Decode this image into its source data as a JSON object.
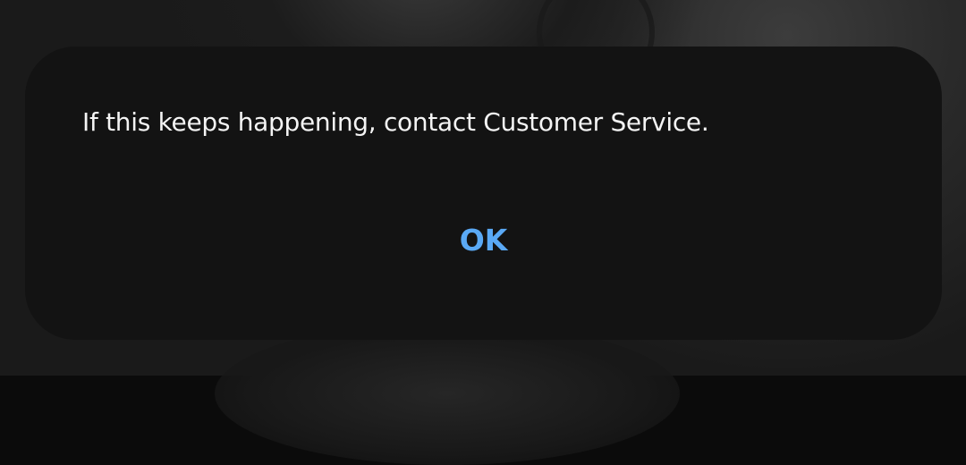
{
  "dialog": {
    "message": "If this keeps happening, contact Customer Service.",
    "ok_label": "OK"
  },
  "colors": {
    "dialog_background": "#131313",
    "message_text": "#f4f4f4",
    "button_accent": "#5aa9f5"
  }
}
